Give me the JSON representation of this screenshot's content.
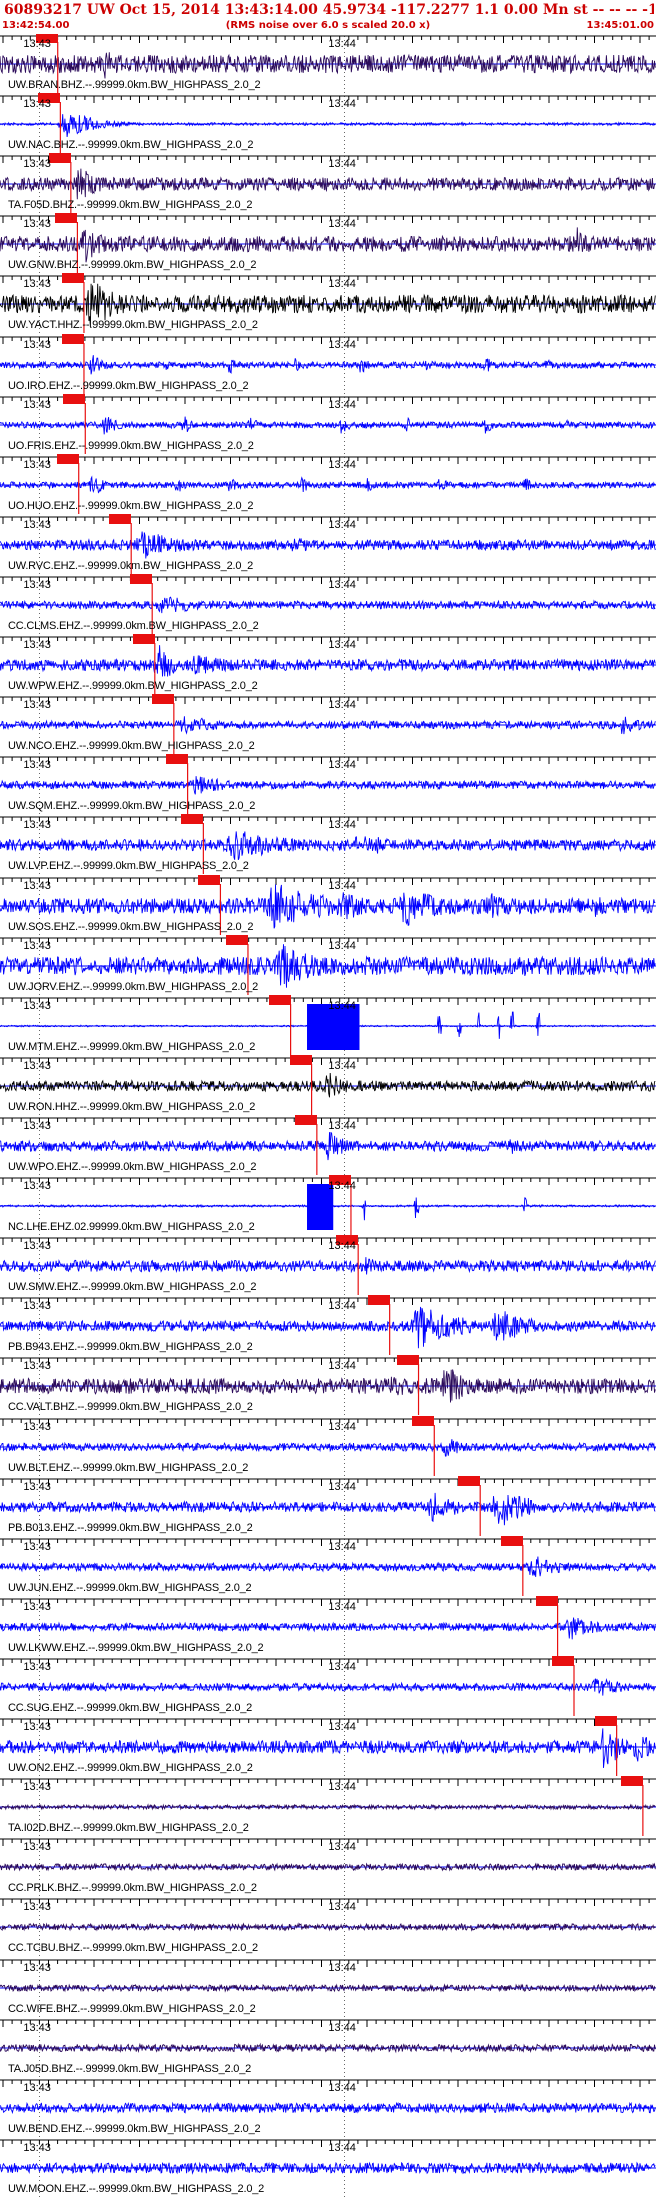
{
  "header": {
    "title": "60893217 UW Oct 15, 2014 13:43:14.00   45.9734 -117.2277  1.1 0.00 Mn st -- -- --  -1",
    "start_time": "13:42:54.00",
    "note": "(RMS noise over 6.0 s scaled 20.0 x)",
    "end_time": "13:45:01.00"
  },
  "time_ticks": {
    "label_a": "13:43",
    "label_b": "13:44"
  },
  "colors": {
    "header_text": "#cc0000",
    "pick": "#e81010",
    "blue": "#0000ff",
    "black": "#000000",
    "purple": "#2b0a5a",
    "zero_line": "#0000ff"
  },
  "tracks": [
    {
      "label": "UW.BRAN.BHZ.--.99999.0km.BW_HIGHPASS_2.0_2",
      "color": "purple",
      "pick": 0.088,
      "amp": 0.35,
      "events": [
        [
          0.16,
          0.6,
          0.015
        ],
        [
          0.73,
          0.35,
          0.01
        ],
        [
          0.82,
          0.3,
          0.01
        ]
      ]
    },
    {
      "label": "UW.NAC.BHZ.--.99999.0km.BW_HIGHPASS_2.0_2",
      "color": "blue",
      "pick": 0.092,
      "amp": 0.05,
      "events": [
        [
          0.1,
          0.6,
          0.03
        ]
      ]
    },
    {
      "label": "TA.F05D.BHZ.--.99999.0km.BW_HIGHPASS_2.0_2",
      "color": "purple",
      "pick": 0.108,
      "amp": 0.25,
      "events": [
        [
          0.12,
          0.8,
          0.02
        ],
        [
          0.38,
          0.3,
          0.02
        ]
      ]
    },
    {
      "label": "UW.GNW.BHZ.--.99999.0km.BW_HIGHPASS_2.0_2",
      "color": "purple",
      "pick": 0.118,
      "amp": 0.3,
      "events": [
        [
          0.13,
          0.9,
          0.02
        ],
        [
          0.88,
          0.7,
          0.01
        ]
      ]
    },
    {
      "label": "UW.YACT.HHZ.--.99999.0km.BW_HIGHPASS_2.0_2",
      "color": "black",
      "pick": 0.128,
      "amp": 0.35,
      "events": [
        [
          0.14,
          0.95,
          0.03
        ]
      ]
    },
    {
      "label": "UO.IRO.EHZ.--.99999.0km.BW_HIGHPASS_2.0_2",
      "color": "blue",
      "pick": 0.128,
      "amp": 0.12,
      "events": [
        [
          0.14,
          0.5,
          0.012
        ],
        [
          0.25,
          0.3,
          0.01
        ],
        [
          0.35,
          0.35,
          0.01
        ],
        [
          0.45,
          0.3,
          0.01
        ],
        [
          0.55,
          0.35,
          0.01
        ],
        [
          0.65,
          0.3,
          0.01
        ],
        [
          0.74,
          0.35,
          0.01
        ],
        [
          0.83,
          0.3,
          0.01
        ]
      ]
    },
    {
      "label": "UO.FRIS.EHZ.--.99999.0km.BW_HIGHPASS_2.0_2",
      "color": "blue",
      "pick": 0.13,
      "amp": 0.12,
      "events": [
        [
          0.16,
          0.5,
          0.012
        ],
        [
          0.28,
          0.4,
          0.01
        ],
        [
          0.38,
          0.35,
          0.01
        ],
        [
          0.52,
          0.35,
          0.01
        ],
        [
          0.62,
          0.3,
          0.01
        ],
        [
          0.74,
          0.35,
          0.01
        ],
        [
          0.86,
          0.3,
          0.01
        ]
      ]
    },
    {
      "label": "UO.HUO.EHZ.--.99999.0km.BW_HIGHPASS_2.0_2",
      "color": "blue",
      "pick": 0.12,
      "amp": 0.12,
      "events": [
        [
          0.14,
          0.5,
          0.012
        ],
        [
          0.27,
          0.35,
          0.01
        ],
        [
          0.35,
          0.35,
          0.01
        ],
        [
          0.46,
          0.35,
          0.01
        ],
        [
          0.56,
          0.3,
          0.01
        ],
        [
          0.67,
          0.35,
          0.01
        ],
        [
          0.8,
          0.3,
          0.01
        ]
      ]
    },
    {
      "label": "UW.RVC.EHZ.--.99999.0km.BW_HIGHPASS_2.0_2",
      "color": "blue",
      "pick": 0.2,
      "amp": 0.2,
      "events": [
        [
          0.22,
          0.55,
          0.05
        ],
        [
          0.45,
          0.3,
          0.04
        ]
      ]
    },
    {
      "label": "CC.CLMS.EHZ.--.99999.0km.BW_HIGHPASS_2.0_2",
      "color": "blue",
      "pick": 0.232,
      "amp": 0.15,
      "events": [
        [
          0.25,
          0.4,
          0.04
        ]
      ]
    },
    {
      "label": "UW.WPW.EHZ.--.99999.0km.BW_HIGHPASS_2.0_2",
      "color": "blue",
      "pick": 0.236,
      "amp": 0.22,
      "events": [
        [
          0.24,
          0.95,
          0.015
        ],
        [
          0.3,
          0.4,
          0.05
        ]
      ]
    },
    {
      "label": "UW.NCO.EHZ.--.99999.0km.BW_HIGHPASS_2.0_2",
      "color": "blue",
      "pick": 0.265,
      "amp": 0.15,
      "events": [
        [
          0.28,
          0.4,
          0.04
        ],
        [
          0.95,
          0.4,
          0.02
        ]
      ]
    },
    {
      "label": "UW.SQM.EHZ.--.99999.0km.BW_HIGHPASS_2.0_2",
      "color": "blue",
      "pick": 0.286,
      "amp": 0.15,
      "events": [
        [
          0.3,
          0.4,
          0.04
        ]
      ]
    },
    {
      "label": "UW.LVP.EHZ.--.99999.0km.BW_HIGHPASS_2.0_2",
      "color": "blue",
      "pick": 0.31,
      "amp": 0.22,
      "events": [
        [
          0.36,
          0.6,
          0.06
        ],
        [
          0.55,
          0.5,
          0.04
        ]
      ]
    },
    {
      "label": "UW.SOS.EHZ.--.99999.0km.BW_HIGHPASS_2.0_2",
      "color": "blue",
      "pick": 0.336,
      "amp": 0.3,
      "events": [
        [
          0.42,
          0.9,
          0.06
        ],
        [
          0.52,
          0.6,
          0.04
        ],
        [
          0.62,
          0.8,
          0.04
        ],
        [
          0.75,
          0.5,
          0.04
        ],
        [
          0.9,
          0.5,
          0.03
        ]
      ]
    },
    {
      "label": "UW.JORV.EHZ.--.99999.0km.BW_HIGHPASS_2.0_2",
      "color": "blue",
      "pick": 0.378,
      "amp": 0.35,
      "events": [
        [
          0.43,
          0.95,
          0.04
        ],
        [
          0.6,
          0.4,
          0.05
        ],
        [
          0.8,
          0.45,
          0.04
        ]
      ]
    },
    {
      "label": "UW.MTM.EHZ.--.99999.0km.BW_HIGHPASS_2.0_2",
      "color": "blue",
      "pick": 0.443,
      "amp": 0.03,
      "block": [
        0.468,
        0.548
      ],
      "spikes": [
        0.67,
        0.7,
        0.73,
        0.76,
        0.78,
        0.82
      ]
    },
    {
      "label": "UW.RON.HHZ.--.99999.0km.BW_HIGHPASS_2.0_2",
      "color": "black",
      "pick": 0.475,
      "amp": 0.2,
      "events": [
        [
          0.5,
          0.6,
          0.02
        ],
        [
          0.55,
          0.3,
          0.02
        ]
      ]
    },
    {
      "label": "UW.WPO.EHZ.--.99999.0km.BW_HIGHPASS_2.0_2",
      "color": "blue",
      "pick": 0.483,
      "amp": 0.2,
      "events": [
        [
          0.5,
          0.6,
          0.02
        ],
        [
          0.78,
          0.35,
          0.02
        ]
      ]
    },
    {
      "label": "NC.LHE.EHZ.02.99999.0km.BW_HIGHPASS_2.0_2",
      "color": "blue",
      "pick": 0.535,
      "amp": 0.04,
      "block": [
        0.468,
        0.508
      ],
      "spikes": [
        0.555,
        0.635,
        0.8
      ]
    },
    {
      "label": "UW.SMW.EHZ.--.99999.0km.BW_HIGHPASS_2.0_2",
      "color": "blue",
      "pick": 0.546,
      "amp": 0.22,
      "events": [
        [
          0.56,
          0.4,
          0.02
        ]
      ]
    },
    {
      "label": "PB.B943.EHZ.--.99999.0km.BW_HIGHPASS_2.0_2",
      "color": "blue",
      "pick": 0.594,
      "amp": 0.2,
      "events": [
        [
          0.64,
          0.9,
          0.04
        ],
        [
          0.76,
          0.8,
          0.03
        ]
      ]
    },
    {
      "label": "CC.VALT.BHZ.--.99999.0km.BW_HIGHPASS_2.0_2",
      "color": "purple",
      "pick": 0.638,
      "amp": 0.3,
      "events": [
        [
          0.68,
          0.95,
          0.02
        ],
        [
          0.6,
          0.4,
          0.05
        ]
      ]
    },
    {
      "label": "UW.BLT.EHZ.--.99999.0km.BW_HIGHPASS_2.0_2",
      "color": "blue",
      "pick": 0.662,
      "amp": 0.15,
      "events": [
        [
          0.68,
          0.4,
          0.02
        ]
      ]
    },
    {
      "label": "PB.B013.EHZ.--.99999.0km.BW_HIGHPASS_2.0_2",
      "color": "blue",
      "pick": 0.732,
      "amp": 0.2,
      "events": [
        [
          0.66,
          0.6,
          0.03
        ],
        [
          0.76,
          0.9,
          0.03
        ]
      ]
    },
    {
      "label": "UW.JUN.EHZ.--.99999.0km.BW_HIGHPASS_2.0_2",
      "color": "blue",
      "pick": 0.797,
      "amp": 0.15,
      "events": [
        [
          0.81,
          0.5,
          0.03
        ]
      ]
    },
    {
      "label": "UW.LKWW.EHZ.--.99999.0km.BW_HIGHPASS_2.0_2",
      "color": "blue",
      "pick": 0.85,
      "amp": 0.15,
      "events": [
        [
          0.87,
          0.5,
          0.03
        ]
      ]
    },
    {
      "label": "CC.SUG.EHZ.--.99999.0km.BW_HIGHPASS_2.0_2",
      "color": "blue",
      "pick": 0.875,
      "amp": 0.15,
      "events": [
        [
          0.91,
          0.4,
          0.03
        ]
      ]
    },
    {
      "label": "UW.ON2.EHZ.--.99999.0km.BW_HIGHPASS_2.0_2",
      "color": "blue",
      "pick": 0.94,
      "amp": 0.25,
      "events": [
        [
          0.92,
          0.95,
          0.02
        ],
        [
          0.97,
          0.6,
          0.02
        ]
      ]
    },
    {
      "label": "TA.I02D.BHZ.--.99999.0km.BW_HIGHPASS_2.0_2",
      "color": "purple",
      "pick": 0.98,
      "amp": 0.08,
      "events": []
    },
    {
      "label": "CC.PRLK.BHZ.--.99999.0km.BW_HIGHPASS_2.0_2",
      "color": "purple",
      "pick": null,
      "amp": 0.12,
      "events": []
    },
    {
      "label": "CC.TCBU.BHZ.--.99999.0km.BW_HIGHPASS_2.0_2",
      "color": "purple",
      "pick": null,
      "amp": 0.12,
      "events": []
    },
    {
      "label": "CC.WIFE.BHZ.--.99999.0km.BW_HIGHPASS_2.0_2",
      "color": "purple",
      "pick": null,
      "amp": 0.12,
      "events": []
    },
    {
      "label": "TA.J05D.BHZ.--.99999.0km.BW_HIGHPASS_2.0_2",
      "color": "purple",
      "pick": null,
      "amp": 0.14,
      "events": []
    },
    {
      "label": "UW.BEND.EHZ.--.99999.0km.BW_HIGHPASS_2.0_2",
      "color": "blue",
      "pick": null,
      "amp": 0.18,
      "events": []
    },
    {
      "label": "UW.MOON.EHZ.--.99999.0km.BW_HIGHPASS_2.0_2",
      "color": "blue",
      "pick": null,
      "amp": 0.2,
      "events": []
    }
  ]
}
